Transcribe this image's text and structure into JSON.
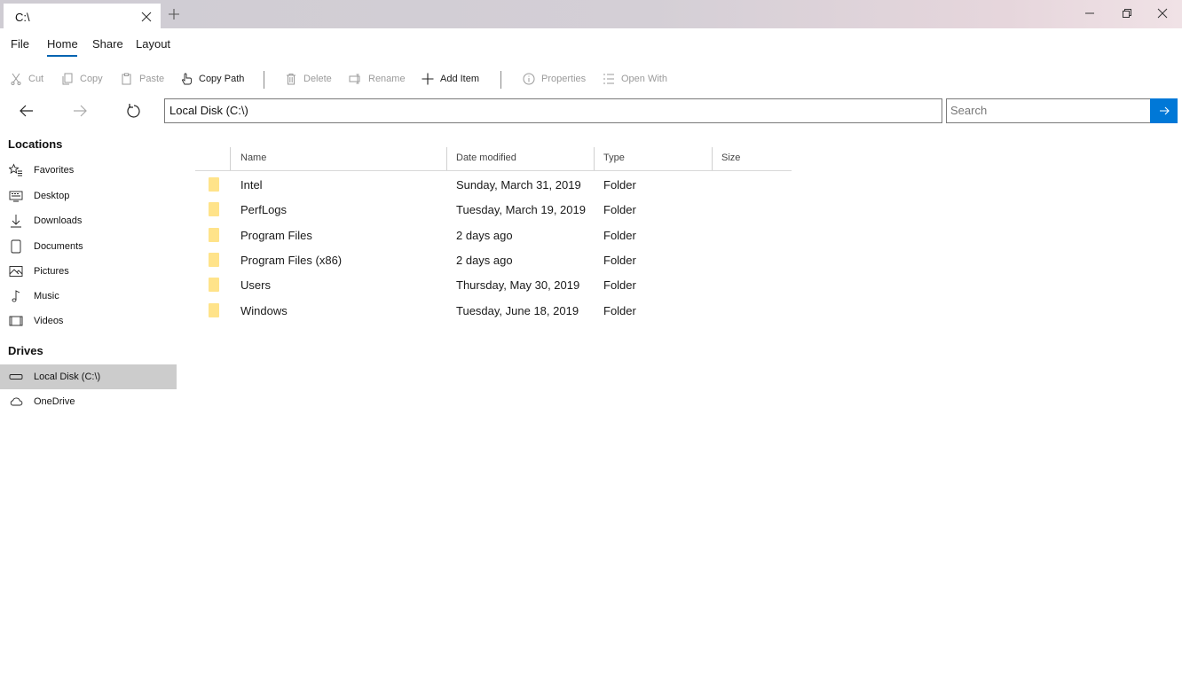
{
  "tab": {
    "title": "C:\\"
  },
  "menu": {
    "file": "File",
    "home": "Home",
    "share": "Share",
    "layout": "Layout"
  },
  "commands": {
    "cut": "Cut",
    "copy": "Copy",
    "paste": "Paste",
    "copy_path": "Copy Path",
    "delete": "Delete",
    "rename": "Rename",
    "add_item": "Add Item",
    "properties": "Properties",
    "open_with": "Open With"
  },
  "address": {
    "path": "Local Disk (C:\\)"
  },
  "search": {
    "placeholder": "Search"
  },
  "sidebar": {
    "locations_header": "Locations",
    "locations": [
      {
        "label": "Favorites",
        "icon": "star-list-icon"
      },
      {
        "label": "Desktop",
        "icon": "desktop-icon"
      },
      {
        "label": "Downloads",
        "icon": "download-icon"
      },
      {
        "label": "Documents",
        "icon": "document-icon"
      },
      {
        "label": "Pictures",
        "icon": "picture-icon"
      },
      {
        "label": "Music",
        "icon": "music-note-icon"
      },
      {
        "label": "Videos",
        "icon": "video-icon"
      }
    ],
    "drives_header": "Drives",
    "drives": [
      {
        "label": "Local Disk (C:\\)",
        "icon": "drive-icon",
        "selected": true
      },
      {
        "label": "OneDrive",
        "icon": "cloud-icon",
        "selected": false
      }
    ]
  },
  "columns": {
    "name": "Name",
    "date": "Date modified",
    "type": "Type",
    "size": "Size"
  },
  "files": [
    {
      "name": "Intel",
      "date": "Sunday, March 31, 2019",
      "type": "Folder",
      "size": ""
    },
    {
      "name": "PerfLogs",
      "date": "Tuesday, March 19, 2019",
      "type": "Folder",
      "size": ""
    },
    {
      "name": "Program Files",
      "date": "2 days ago",
      "type": "Folder",
      "size": ""
    },
    {
      "name": "Program Files (x86)",
      "date": "2 days ago",
      "type": "Folder",
      "size": ""
    },
    {
      "name": "Users",
      "date": "Thursday, May 30, 2019",
      "type": "Folder",
      "size": ""
    },
    {
      "name": "Windows",
      "date": "Tuesday, June 18, 2019",
      "type": "Folder",
      "size": ""
    }
  ],
  "colors": {
    "accent": "#0078d7",
    "folder": "#ffe38a",
    "selected": "#cccccc"
  }
}
